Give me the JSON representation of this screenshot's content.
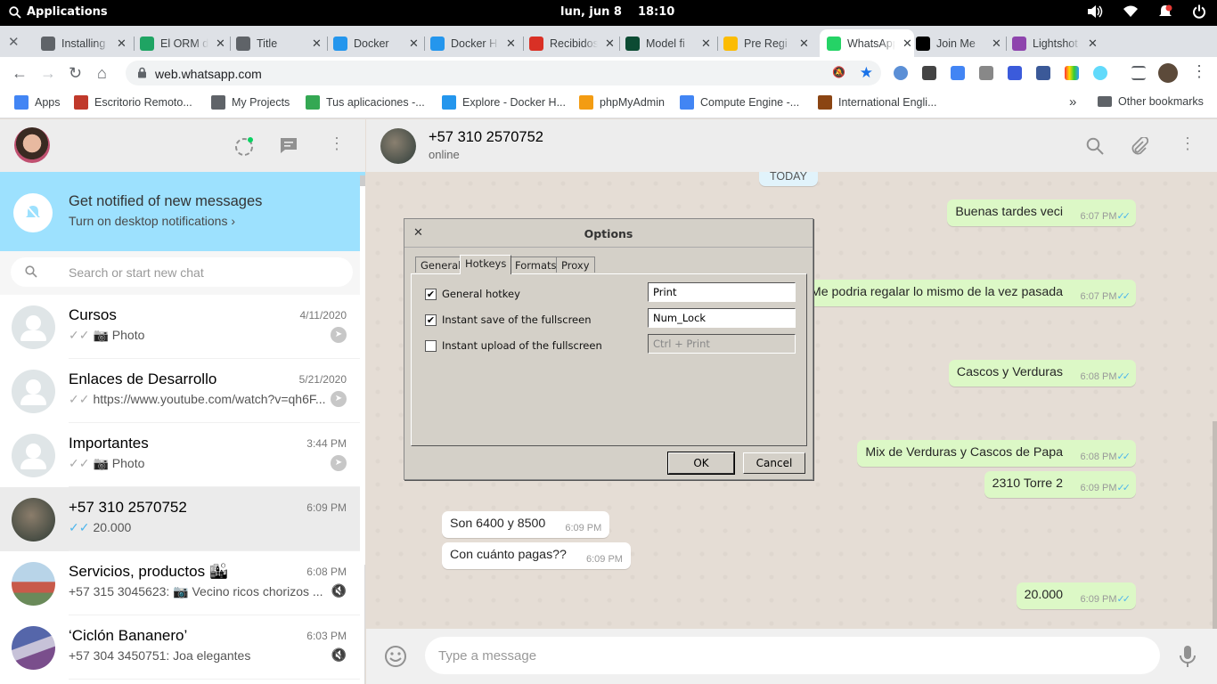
{
  "os": {
    "apps_label": "Applications",
    "date": "lun, jun  8",
    "time": "18:10"
  },
  "browser": {
    "tabs": [
      {
        "label": "Installing",
        "color": "#5f6368"
      },
      {
        "label": "El ORM de",
        "color": "#1fa463"
      },
      {
        "label": "Title",
        "color": "#5f6368"
      },
      {
        "label": "Docker",
        "color": "#2496ed"
      },
      {
        "label": "Docker H",
        "color": "#2496ed"
      },
      {
        "label": "Recibidos",
        "color": "#d93025"
      },
      {
        "label": "Model fi",
        "color": "#0c4b33"
      },
      {
        "label": "Pre Regi",
        "color": "#fbbc04"
      },
      {
        "label": "WhatsApp",
        "color": "#25d366"
      },
      {
        "label": "Join Me",
        "color": "#000000"
      },
      {
        "label": "Lightshot",
        "color": "#8e44ad"
      }
    ],
    "url": "web.whatsapp.com",
    "bookmarks": [
      {
        "label": "Apps",
        "color": "#4285f4"
      },
      {
        "label": "Escritorio Remoto...",
        "color": "#c0392b"
      },
      {
        "label": "My Projects",
        "color": "#5f6368"
      },
      {
        "label": "Tus aplicaciones -...",
        "color": "#34a853"
      },
      {
        "label": "Explore - Docker H...",
        "color": "#2496ed"
      },
      {
        "label": "phpMyAdmin",
        "color": "#f39c12"
      },
      {
        "label": "Compute Engine -...",
        "color": "#4285f4"
      },
      {
        "label": "International Engli...",
        "color": "#8b4513"
      }
    ],
    "other_bookmarks": "Other bookmarks"
  },
  "whatsapp": {
    "notification": {
      "title": "Get notified of new messages",
      "subtitle": "Turn on desktop notifications ›"
    },
    "search_placeholder": "Search or start new chat",
    "chats": [
      {
        "name": "Cursos",
        "time": "4/11/2020",
        "preview": "Photo",
        "camera": true,
        "tick": "✓✓",
        "read": false,
        "group": true,
        "trailing": "status"
      },
      {
        "name": "Enlaces de Desarrollo",
        "time": "5/21/2020",
        "preview": "https://www.youtube.com/watch?v=qh6F...",
        "camera": false,
        "tick": "✓✓",
        "read": false,
        "group": true,
        "trailing": "status"
      },
      {
        "name": "Importantes",
        "time": "3:44 PM",
        "preview": "Photo",
        "camera": true,
        "tick": "✓✓",
        "read": false,
        "group": true,
        "trailing": "status"
      },
      {
        "name": "+57 310 2570752",
        "time": "6:09 PM",
        "preview": "20.000",
        "camera": false,
        "tick": "✓✓",
        "read": true,
        "group": false,
        "trailing": "none",
        "selected": true
      },
      {
        "name": "Servicios, productos 🏙",
        "time": "6:08 PM",
        "preview": "+57 315 3045623: 📷 Vecino ricos chorizos ...",
        "camera": false,
        "tick": "",
        "read": false,
        "group": false,
        "trailing": "mute"
      },
      {
        "name": "‘Ciclón Bananero’",
        "time": "6:03 PM",
        "preview": "+57 304 3450751: Joa elegantes",
        "camera": false,
        "tick": "",
        "read": false,
        "group": false,
        "trailing": "mute"
      }
    ],
    "active_chat": {
      "name": "+57 310 2570752",
      "status": "online",
      "day_label": "TODAY",
      "messages": [
        {
          "dir": "out",
          "text": "Buenas tardes veci",
          "time": "6:07 PM"
        },
        {
          "dir": "out",
          "text": "Me podria regalar lo mismo de la vez pasada",
          "time": "6:07 PM"
        },
        {
          "dir": "out",
          "text": "Cascos y Verduras",
          "time": "6:08 PM"
        },
        {
          "dir": "out",
          "text": "Mix de Verduras y Cascos de Papa",
          "time": "6:08 PM"
        },
        {
          "dir": "out",
          "text": "2310 Torre 2",
          "time": "6:09 PM"
        },
        {
          "dir": "in",
          "text": "Son 6400 y 8500",
          "time": "6:09 PM"
        },
        {
          "dir": "in",
          "text": "Con cuánto pagas??",
          "time": "6:09 PM"
        },
        {
          "dir": "out",
          "text": "20.000",
          "time": "6:09 PM"
        }
      ]
    },
    "composer_placeholder": "Type a message"
  },
  "dialog": {
    "title": "Options",
    "tabs": [
      "General",
      "Hotkeys",
      "Formats",
      "Proxy"
    ],
    "active_tab": "Hotkeys",
    "hotkeys": [
      {
        "label": "General hotkey",
        "checked": true,
        "value": "Print",
        "enabled": true
      },
      {
        "label": "Instant save of the fullscreen",
        "checked": true,
        "value": "Num_Lock",
        "enabled": true
      },
      {
        "label": "Instant upload of the fullscreen",
        "checked": false,
        "value": "Ctrl + Print",
        "enabled": false
      }
    ],
    "ok_label": "OK",
    "cancel_label": "Cancel"
  }
}
